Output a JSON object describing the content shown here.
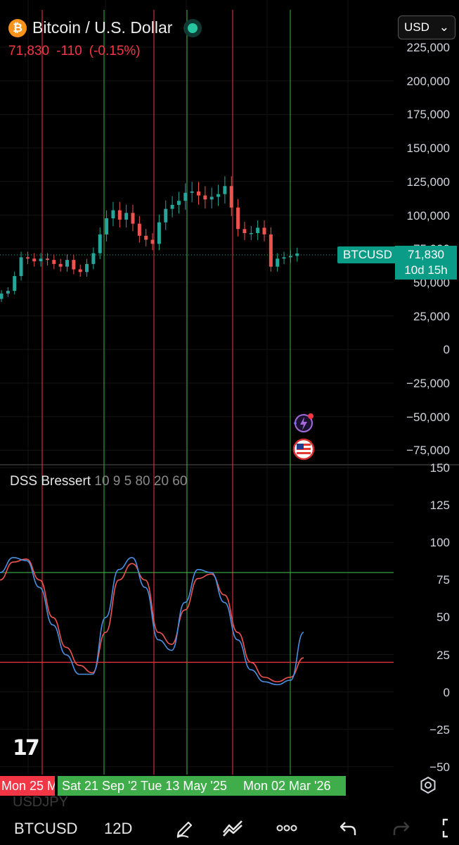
{
  "header": {
    "logo_glyph": "₿",
    "title": "Bitcoin / U.S. Dollar",
    "last_price": "71,830",
    "change": "-110",
    "change_pct": "(-0.15%)",
    "currency": "USD",
    "currency_caret": "⌄"
  },
  "price_axis": {
    "labels": [
      "225,000",
      "200,000",
      "175,000",
      "150,000",
      "125,000",
      "100,000",
      "75,000",
      "50,000",
      "25,000",
      "0",
      "−25,000",
      "−50,000",
      "−75,000"
    ]
  },
  "price_tag": {
    "symbol": "BTCUSD",
    "price": "71,830",
    "countdown": "10d 15h"
  },
  "indicator": {
    "name": "DSS Bressert",
    "params": "10 9 5 80 20 60",
    "axis_labels": [
      "150",
      "125",
      "100",
      "75",
      "50",
      "25",
      "0",
      "−25",
      "−50"
    ],
    "upper_level": 80,
    "lower_level": 20
  },
  "time_axis": {
    "tags": [
      {
        "label": "Mon 25 M",
        "color": "#f23645"
      },
      {
        "label": "Sat 21 Sep '2",
        "color": "#3fae4a"
      },
      {
        "label": "Tue 13 May '25",
        "color": "#3fae4a"
      },
      {
        "label": "Mon 02 Mar '26",
        "color": "#3fae4a"
      }
    ]
  },
  "watermark": {
    "logo": "17",
    "ghost_symbol": "USDJPY"
  },
  "toolbar": {
    "symbol": "BTCUSD",
    "interval": "12D"
  },
  "colors": {
    "up": "#26a69a",
    "down": "#ef5350",
    "accent": "#0b9c87",
    "dss_line": "#4a90e2",
    "signal_line": "#f0554f"
  },
  "chart_data": {
    "type": "candlestick",
    "y_range": [
      -80000,
      230000
    ],
    "candles_approx_close": [
      42000,
      44000,
      55000,
      69000,
      68000,
      66000,
      68000,
      67000,
      64000,
      62000,
      67000,
      60000,
      58000,
      64000,
      72000,
      86000,
      98000,
      104000,
      97000,
      102000,
      94000,
      85000,
      82000,
      79000,
      95000,
      105000,
      108000,
      111000,
      117000,
      118000,
      115000,
      112000,
      114000,
      116000,
      122000,
      106000,
      90000,
      87000,
      87000,
      91000,
      86000,
      62000,
      68000,
      69000,
      70000,
      71830
    ],
    "indicator": {
      "dss": [
        80,
        90,
        88,
        70,
        45,
        25,
        12,
        12,
        50,
        82,
        90,
        70,
        35,
        28,
        60,
        82,
        80,
        60,
        35,
        15,
        7,
        5,
        8,
        40
      ],
      "signal": [
        75,
        87,
        89,
        75,
        50,
        30,
        18,
        13,
        40,
        75,
        86,
        75,
        40,
        32,
        55,
        76,
        79,
        65,
        40,
        20,
        10,
        7,
        10,
        23
      ]
    }
  }
}
